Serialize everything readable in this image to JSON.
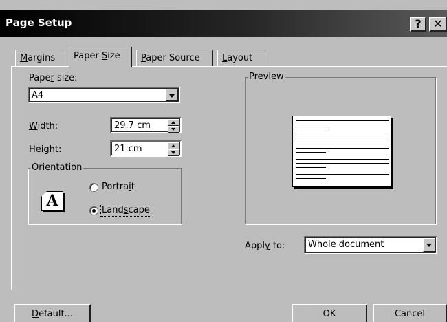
{
  "window": {
    "title": "Page Setup",
    "help_glyph": "?",
    "close_glyph": "✕"
  },
  "tabs": [
    {
      "pre": "",
      "key": "M",
      "post": "argins"
    },
    {
      "pre": "Paper ",
      "key": "S",
      "post": "ize"
    },
    {
      "pre": "",
      "key": "P",
      "post": "aper Source"
    },
    {
      "pre": "",
      "key": "L",
      "post": "ayout"
    }
  ],
  "active_tab": "Paper Size",
  "paper_size": {
    "label_pre": "Pape",
    "label_key": "r",
    "label_post": " size:",
    "value": "A4"
  },
  "width": {
    "label_key": "W",
    "label_post": "idth:",
    "value": "29.7 cm"
  },
  "height": {
    "label_pre": "He",
    "label_key": "i",
    "label_post": "ght:",
    "value": "21 cm"
  },
  "orientation": {
    "legend": "Orientation",
    "icon_letter": "A",
    "portrait": {
      "pre": "Portra",
      "key": "i",
      "post": "t",
      "checked": false
    },
    "landscape": {
      "pre": "Land",
      "key": "s",
      "post": "cape",
      "checked": true
    }
  },
  "preview": {
    "legend": "Preview"
  },
  "apply_to": {
    "label_pre": "Appl",
    "label_key": "y",
    "label_post": " to:",
    "value": "Whole document"
  },
  "buttons": {
    "default": {
      "key": "D",
      "post": "efault..."
    },
    "ok": "OK",
    "cancel": "Cancel"
  }
}
